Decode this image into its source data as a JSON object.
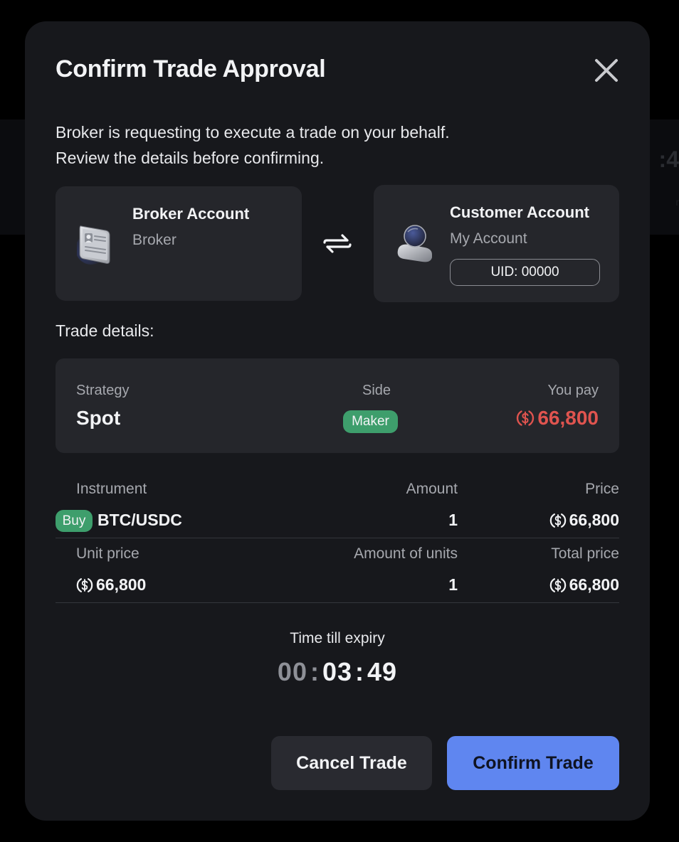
{
  "background": {
    "ghost_text_1": ":4",
    "ghost_text_2": "r"
  },
  "modal": {
    "title": "Confirm Trade Approval",
    "close_icon": "close-icon",
    "intro_line_1": "Broker is requesting to execute a trade on your behalf.",
    "intro_line_2": "Review the details before confirming."
  },
  "broker_account": {
    "title": "Broker Account",
    "name": "Broker",
    "icon": "id-card-icon"
  },
  "swap_icon": "swap-arrows-icon",
  "customer_account": {
    "title": "Customer Account",
    "name": "My Account",
    "uid": "UID: 00000",
    "icon": "user-avatar-icon"
  },
  "trade_details": {
    "label": "Trade details:",
    "strategy_label": "Strategy",
    "strategy_value": "Spot",
    "side_label": "Side",
    "side_value": "Maker",
    "pay_label": "You pay",
    "pay_value": "66,800",
    "pay_color": "#e0544f",
    "currency_icon": "usdc-dollar-icon"
  },
  "instrument_row": {
    "instrument_label": "Instrument",
    "amount_label": "Amount",
    "price_label": "Price",
    "side_badge": "Buy",
    "instrument_value": "BTC/USDC",
    "amount_value": "1",
    "price_value": "66,800"
  },
  "unit_row": {
    "unit_price_label": "Unit price",
    "amount_units_label": "Amount of units",
    "total_price_label": "Total price",
    "unit_price_value": "66,800",
    "amount_units_value": "1",
    "total_price_value": "66,800"
  },
  "expiry": {
    "label": "Time till expiry",
    "hours": "00",
    "minutes": "03",
    "seconds": "49",
    "separator": ":"
  },
  "buttons": {
    "cancel": "Cancel Trade",
    "confirm": "Confirm Trade"
  },
  "colors": {
    "accent": "#5f86f0",
    "positive": "#3e9e6c",
    "negative": "#e0544f",
    "modal_bg": "#17181c",
    "card_bg": "#25262b"
  }
}
